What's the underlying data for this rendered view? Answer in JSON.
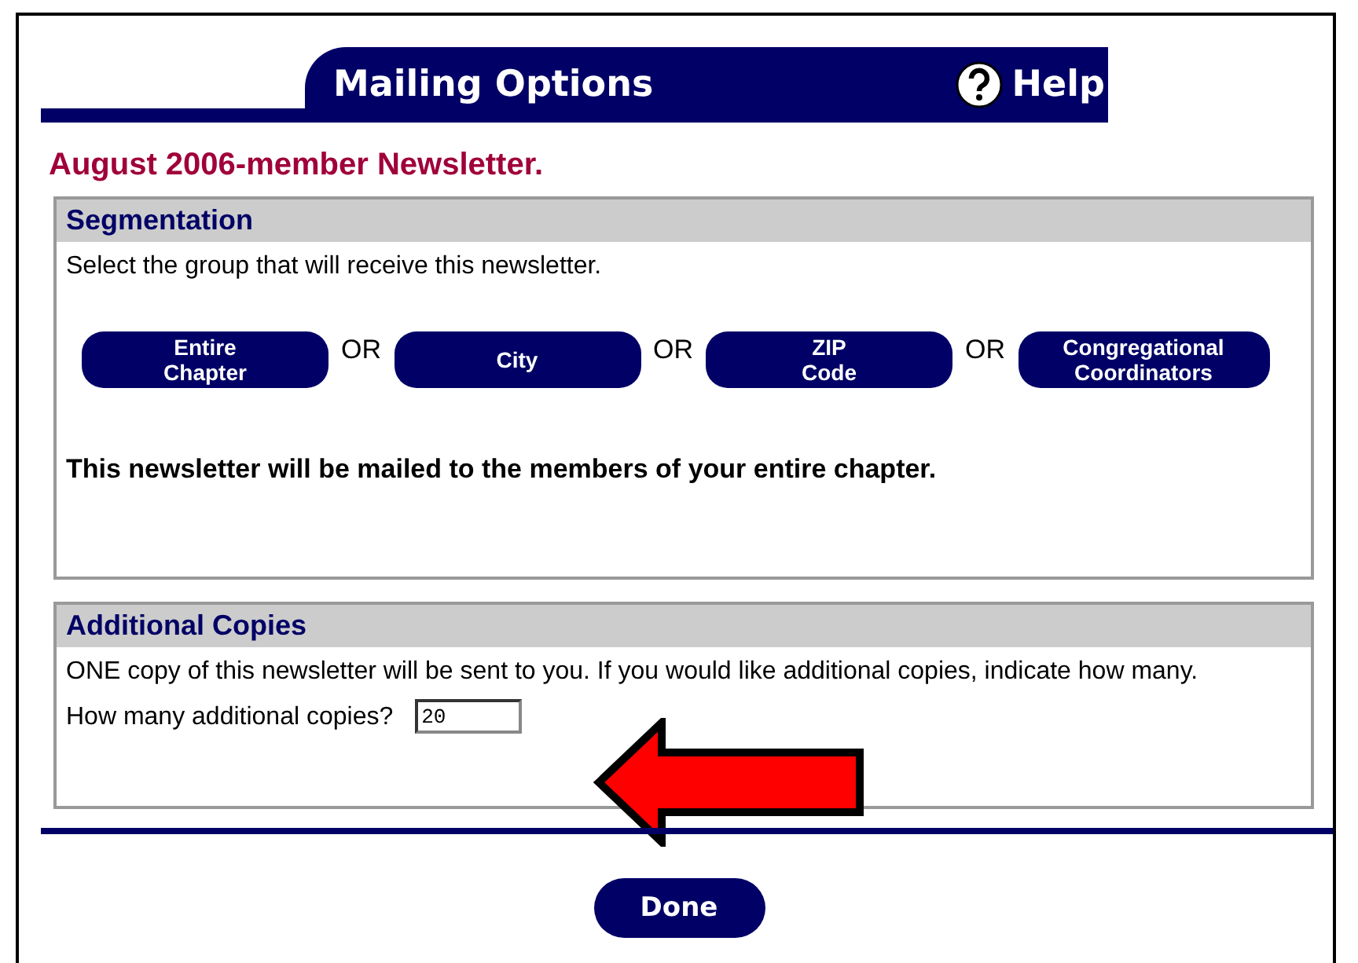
{
  "header": {
    "title": "Mailing Options",
    "help": "Help"
  },
  "newsletter_title": "August 2006-member Newsletter.",
  "segmentation": {
    "heading": "Segmentation",
    "instruction": "Select the group that will receive this newsletter.",
    "options": [
      {
        "label": "Entire\nChapter"
      },
      {
        "label": "City"
      },
      {
        "label": "ZIP\nCode"
      },
      {
        "label": "Congregational\nCoordinators"
      }
    ],
    "separators": [
      "OR",
      "OR",
      "OR"
    ],
    "message": "This newsletter will be mailed to the members of your entire chapter."
  },
  "additional_copies": {
    "heading": "Additional Copies",
    "text": "ONE copy of this newsletter will be sent to you. If you would like additional copies, indicate how many.",
    "question": "How many additional copies?",
    "value": "20"
  },
  "done": "Done"
}
